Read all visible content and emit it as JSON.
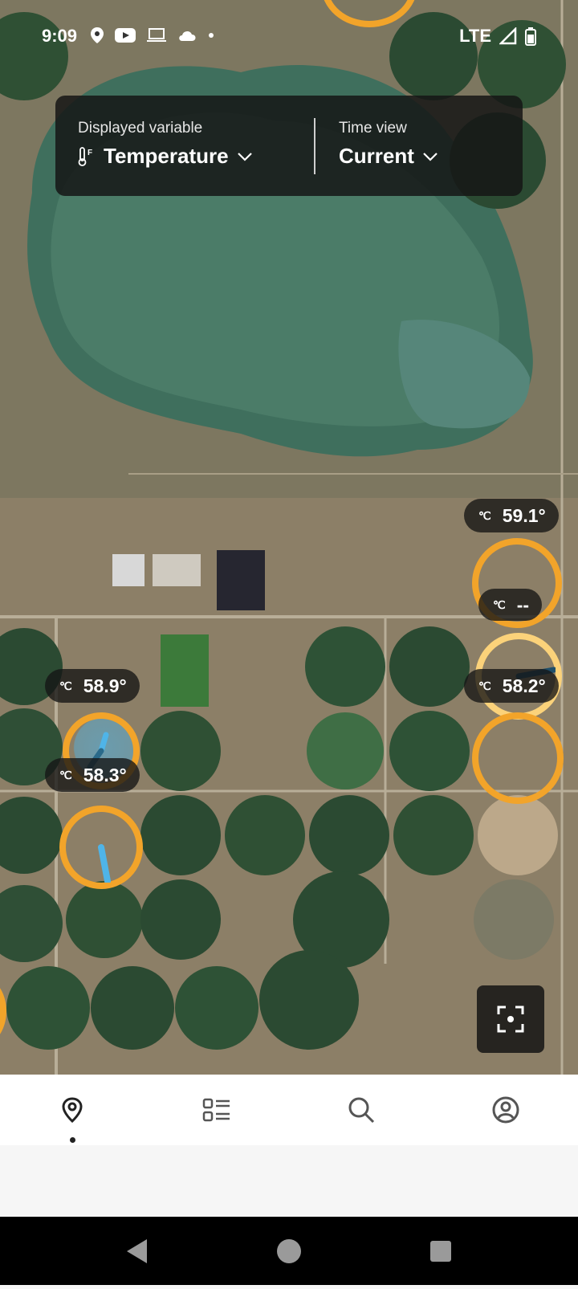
{
  "status_bar": {
    "time": "9:09",
    "network": "LTE"
  },
  "header_panel": {
    "variable_label": "Displayed variable",
    "variable_value": "Temperature",
    "time_label": "Time view",
    "time_value": "Current"
  },
  "map": {
    "sensors": [
      {
        "id": "sensor-a",
        "value": "59.1°"
      },
      {
        "id": "sensor-b",
        "value": "--"
      },
      {
        "id": "sensor-c",
        "value": "58.2°"
      },
      {
        "id": "sensor-d",
        "value": "58.9°"
      },
      {
        "id": "sensor-e",
        "value": "58.3°"
      }
    ],
    "accent_color": "#f2a42a",
    "irrigation_color": "#4fb4e8"
  },
  "bottom_nav": {
    "items": [
      {
        "name": "map",
        "icon": "map-pin-icon",
        "active": true
      },
      {
        "name": "list",
        "icon": "list-icon",
        "active": false
      },
      {
        "name": "search",
        "icon": "search-icon",
        "active": false
      },
      {
        "name": "account",
        "icon": "account-icon",
        "active": false
      }
    ]
  }
}
